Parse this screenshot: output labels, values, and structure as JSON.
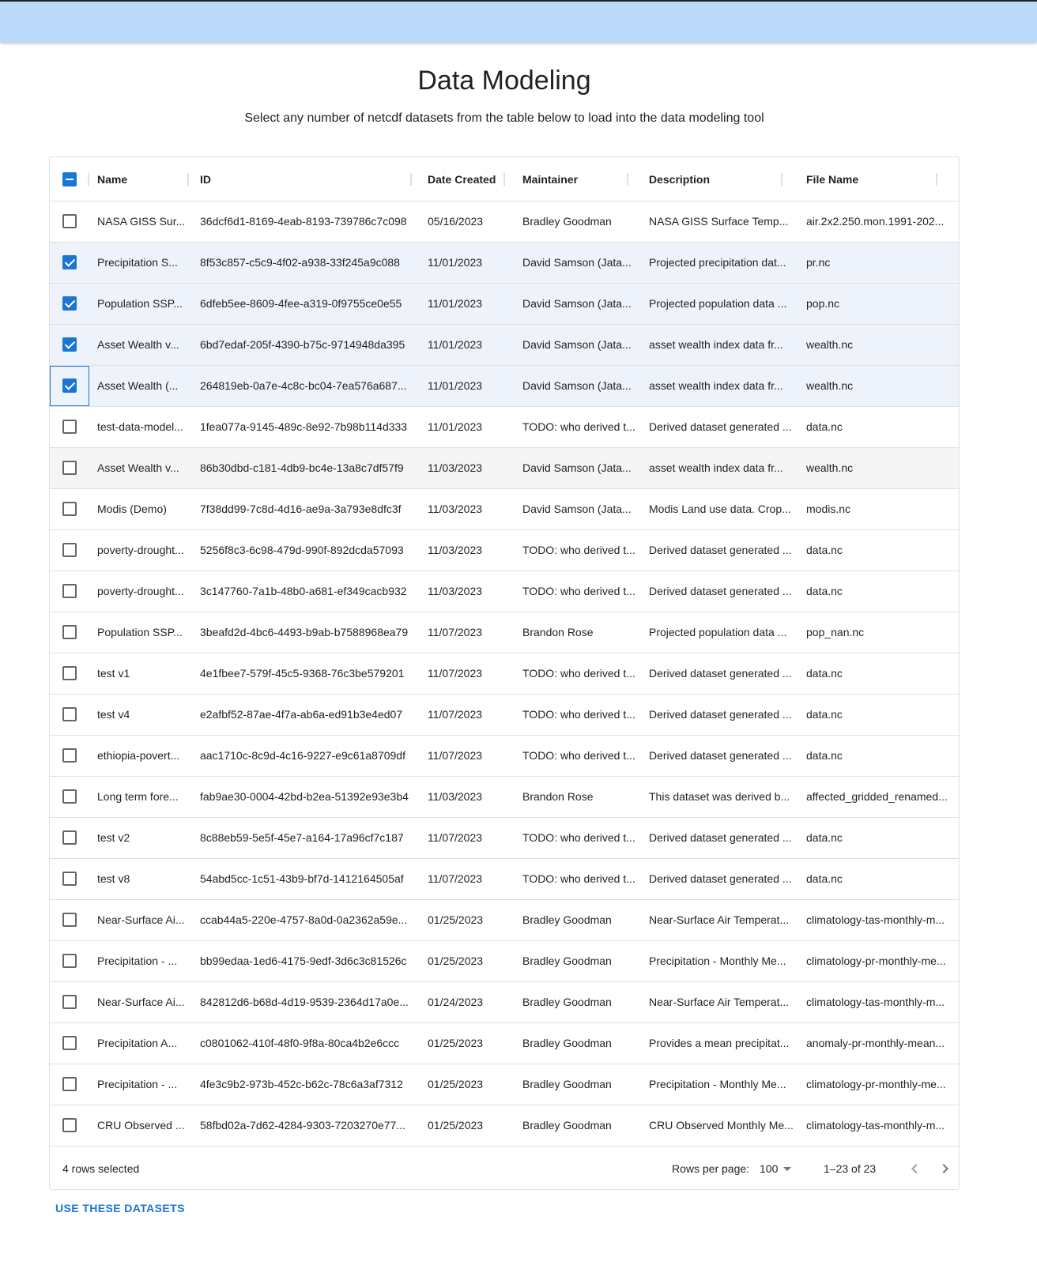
{
  "page": {
    "title": "Data Modeling",
    "subtitle": "Select any number of netcdf datasets from the table below to load into the data modeling tool"
  },
  "table": {
    "columns": {
      "name": "Name",
      "id": "ID",
      "date": "Date Created",
      "maintainer": "Maintainer",
      "description": "Description",
      "file": "File Name"
    },
    "header_checkbox_state": "indeterminate",
    "rows": [
      {
        "name": "NASA GISS Sur...",
        "id": "36dcf6d1-8169-4eab-8193-739786c7c098",
        "date": "05/16/2023",
        "maintainer": "Bradley Goodman",
        "description": "NASA GISS Surface Temp...",
        "file": "air.2x2.250.mon.1991-202...",
        "selected": false
      },
      {
        "name": "Precipitation S...",
        "id": "8f53c857-c5c9-4f02-a938-33f245a9c088",
        "date": "11/01/2023",
        "maintainer": "David Samson (Jata...",
        "description": "Projected precipitation dat...",
        "file": "pr.nc",
        "selected": true
      },
      {
        "name": "Population SSP...",
        "id": "6dfeb5ee-8609-4fee-a319-0f9755ce0e55",
        "date": "11/01/2023",
        "maintainer": "David Samson (Jata...",
        "description": "Projected population data ...",
        "file": "pop.nc",
        "selected": true
      },
      {
        "name": "Asset Wealth v...",
        "id": "6bd7edaf-205f-4390-b75c-9714948da395",
        "date": "11/01/2023",
        "maintainer": "David Samson (Jata...",
        "description": "asset wealth index data fr...",
        "file": "wealth.nc",
        "selected": true
      },
      {
        "name": "Asset Wealth (...",
        "id": "264819eb-0a7e-4c8c-bc04-7ea576a687...",
        "date": "11/01/2023",
        "maintainer": "David Samson (Jata...",
        "description": "asset wealth index data fr...",
        "file": "wealth.nc",
        "selected": true,
        "focused": true
      },
      {
        "name": "test-data-model...",
        "id": "1fea077a-9145-489c-8e92-7b98b114d333",
        "date": "11/01/2023",
        "maintainer": "TODO: who derived t...",
        "description": "Derived dataset generated ...",
        "file": "data.nc",
        "selected": false
      },
      {
        "name": "Asset Wealth v...",
        "id": "86b30dbd-c181-4db9-bc4e-13a8c7df57f9",
        "date": "11/03/2023",
        "maintainer": "David Samson (Jata...",
        "description": "asset wealth index data fr...",
        "file": "wealth.nc",
        "selected": false,
        "hovered": true
      },
      {
        "name": "Modis (Demo)",
        "id": "7f38dd99-7c8d-4d16-ae9a-3a793e8dfc3f",
        "date": "11/03/2023",
        "maintainer": "David Samson (Jata...",
        "description": "Modis Land use data. Crop...",
        "file": "modis.nc",
        "selected": false
      },
      {
        "name": "poverty-drought...",
        "id": "5256f8c3-6c98-479d-990f-892dcda57093",
        "date": "11/03/2023",
        "maintainer": "TODO: who derived t...",
        "description": "Derived dataset generated ...",
        "file": "data.nc",
        "selected": false
      },
      {
        "name": "poverty-drought...",
        "id": "3c147760-7a1b-48b0-a681-ef349cacb932",
        "date": "11/03/2023",
        "maintainer": "TODO: who derived t...",
        "description": "Derived dataset generated ...",
        "file": "data.nc",
        "selected": false
      },
      {
        "name": "Population SSP...",
        "id": "3beafd2d-4bc6-4493-b9ab-b7588968ea79",
        "date": "11/07/2023",
        "maintainer": "Brandon Rose",
        "description": "Projected population data ...",
        "file": "pop_nan.nc",
        "selected": false
      },
      {
        "name": "test v1",
        "id": "4e1fbee7-579f-45c5-9368-76c3be579201",
        "date": "11/07/2023",
        "maintainer": "TODO: who derived t...",
        "description": "Derived dataset generated ...",
        "file": "data.nc",
        "selected": false
      },
      {
        "name": "test v4",
        "id": "e2afbf52-87ae-4f7a-ab6a-ed91b3e4ed07",
        "date": "11/07/2023",
        "maintainer": "TODO: who derived t...",
        "description": "Derived dataset generated ...",
        "file": "data.nc",
        "selected": false
      },
      {
        "name": "ethiopia-povert...",
        "id": "aac1710c-8c9d-4c16-9227-e9c61a8709df",
        "date": "11/07/2023",
        "maintainer": "TODO: who derived t...",
        "description": "Derived dataset generated ...",
        "file": "data.nc",
        "selected": false
      },
      {
        "name": "Long term fore...",
        "id": "fab9ae30-0004-42bd-b2ea-51392e93e3b4",
        "date": "11/03/2023",
        "maintainer": "Brandon Rose",
        "description": "This dataset was derived b...",
        "file": "affected_gridded_renamed...",
        "selected": false
      },
      {
        "name": "test v2",
        "id": "8c88eb59-5e5f-45e7-a164-17a96cf7c187",
        "date": "11/07/2023",
        "maintainer": "TODO: who derived t...",
        "description": "Derived dataset generated ...",
        "file": "data.nc",
        "selected": false
      },
      {
        "name": "test v8",
        "id": "54abd5cc-1c51-43b9-bf7d-1412164505af",
        "date": "11/07/2023",
        "maintainer": "TODO: who derived t...",
        "description": "Derived dataset generated ...",
        "file": "data.nc",
        "selected": false
      },
      {
        "name": "Near-Surface Ai...",
        "id": "ccab44a5-220e-4757-8a0d-0a2362a59e...",
        "date": "01/25/2023",
        "maintainer": "Bradley Goodman",
        "description": "Near-Surface Air Temperat...",
        "file": "climatology-tas-monthly-m...",
        "selected": false
      },
      {
        "name": "Precipitation - ...",
        "id": "bb99edaa-1ed6-4175-9edf-3d6c3c81526c",
        "date": "01/25/2023",
        "maintainer": "Bradley Goodman",
        "description": "Precipitation - Monthly Me...",
        "file": "climatology-pr-monthly-me...",
        "selected": false
      },
      {
        "name": "Near-Surface Ai...",
        "id": "842812d6-b68d-4d19-9539-2364d17a0e...",
        "date": "01/24/2023",
        "maintainer": "Bradley Goodman",
        "description": "Near-Surface Air Temperat...",
        "file": "climatology-tas-monthly-m...",
        "selected": false
      },
      {
        "name": "Precipitation A...",
        "id": "c0801062-410f-48f0-9f8a-80ca4b2e6ccc",
        "date": "01/25/2023",
        "maintainer": "Bradley Goodman",
        "description": "Provides a mean precipitat...",
        "file": "anomaly-pr-monthly-mean...",
        "selected": false
      },
      {
        "name": "Precipitation - ...",
        "id": "4fe3c9b2-973b-452c-b62c-78c6a3af7312",
        "date": "01/25/2023",
        "maintainer": "Bradley Goodman",
        "description": "Precipitation - Monthly Me...",
        "file": "climatology-pr-monthly-me...",
        "selected": false
      },
      {
        "name": "CRU Observed ...",
        "id": "58fbd02a-7d62-4284-9303-7203270e77...",
        "date": "01/25/2023",
        "maintainer": "Bradley Goodman",
        "description": "CRU Observed Monthly Me...",
        "file": "climatology-tas-monthly-m...",
        "selected": false
      }
    ]
  },
  "footer": {
    "selected_text": "4 rows selected",
    "rows_per_page_label": "Rows per page:",
    "rows_per_page_value": "100",
    "range_text": "1–23 of 23",
    "prev_icon": "chevron-left-icon",
    "next_icon": "chevron-right-icon"
  },
  "actions": {
    "use_button": "USE THESE DATASETS"
  },
  "colors": {
    "appbar": "#bbdafa",
    "accent": "#1976d2",
    "selected_row": "#eef3fb"
  }
}
